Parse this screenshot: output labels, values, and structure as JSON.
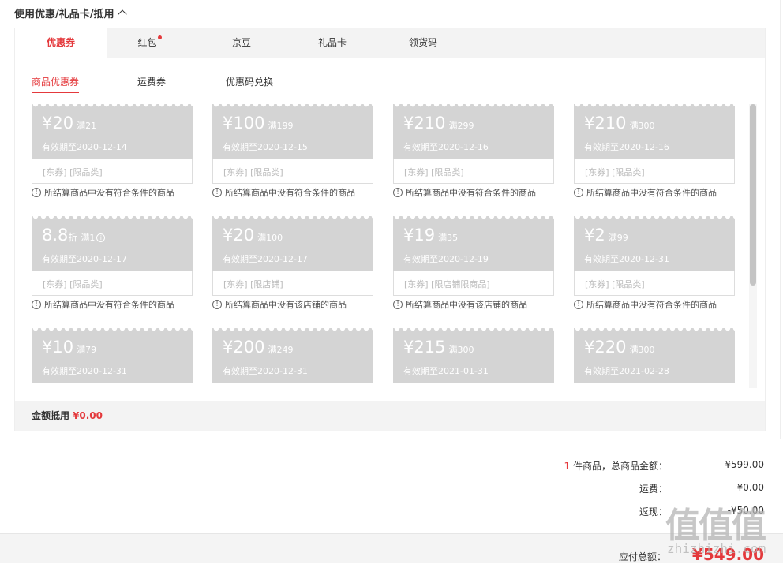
{
  "section": {
    "title": "使用优惠/礼品卡/抵用"
  },
  "tabs": [
    {
      "label": "优惠券",
      "active": true
    },
    {
      "label": "红包",
      "dot": true
    },
    {
      "label": "京豆"
    },
    {
      "label": "礼品卡"
    },
    {
      "label": "领货码"
    }
  ],
  "subtabs": [
    {
      "label": "商品优惠券",
      "active": true
    },
    {
      "label": "运费券"
    },
    {
      "label": "优惠码兑换"
    }
  ],
  "coupons": [
    {
      "amount": "¥20",
      "cond": "满21",
      "expiry": "有效期至2020-12-14",
      "tags": "[东券]  [限品类]",
      "note": "所结算商品中没有符合条件的商品"
    },
    {
      "amount": "¥100",
      "cond": "满199",
      "expiry": "有效期至2020-12-15",
      "tags": "[东券]  [限品类]",
      "note": "所结算商品中没有符合条件的商品"
    },
    {
      "amount": "¥210",
      "cond": "满299",
      "expiry": "有效期至2020-12-16",
      "tags": "[东券]  [限品类]",
      "note": "所结算商品中没有符合条件的商品"
    },
    {
      "amount": "¥210",
      "cond": "满300",
      "expiry": "有效期至2020-12-16",
      "tags": "[东券]  [限品类]",
      "note": "所结算商品中没有符合条件的商品"
    },
    {
      "amount": "8.8",
      "unit": "折",
      "cond": "满1",
      "expiry": "有效期至2020-12-17",
      "tags": "[东券]  [限品类]",
      "note": "所结算商品中没有符合条件的商品"
    },
    {
      "amount": "¥20",
      "cond": "满100",
      "expiry": "有效期至2020-12-17",
      "tags": "[东券]  [限店铺]",
      "note": "所结算商品中没有该店铺的商品"
    },
    {
      "amount": "¥19",
      "cond": "满35",
      "expiry": "有效期至2020-12-19",
      "tags": "[东券]  [限店铺限商品]",
      "note": "所结算商品中没有该店铺的商品"
    },
    {
      "amount": "¥2",
      "cond": "满99",
      "expiry": "有效期至2020-12-31",
      "tags": "[东券]  [限品类]",
      "note": "所结算商品中没有符合条件的商品"
    },
    {
      "amount": "¥10",
      "cond": "满79",
      "expiry": "有效期至2020-12-31",
      "tags": "",
      "note": ""
    },
    {
      "amount": "¥200",
      "cond": "满249",
      "expiry": "有效期至2020-12-31",
      "tags": "",
      "note": ""
    },
    {
      "amount": "¥215",
      "cond": "满300",
      "expiry": "有效期至2021-01-31",
      "tags": "",
      "note": ""
    },
    {
      "amount": "¥220",
      "cond": "满300",
      "expiry": "有效期至2021-02-28",
      "tags": "",
      "note": ""
    }
  ],
  "discount": {
    "label": "金额抵用",
    "amount": "¥0.00"
  },
  "summary": {
    "count": "1",
    "count_label": "件商品，总商品金额：",
    "goods_total": "¥599.00",
    "shipping_label": "运费：",
    "shipping": "¥0.00",
    "rebate_label": "返现：",
    "rebate": "-¥50.00"
  },
  "footer": {
    "label": "应付总额：",
    "total": "¥549.00"
  },
  "watermark": {
    "logo": "值值值",
    "site": "zhizhizhi.com"
  },
  "colors": {
    "accent": "#e4393c",
    "coupon_bg": "#d4d4d4"
  }
}
